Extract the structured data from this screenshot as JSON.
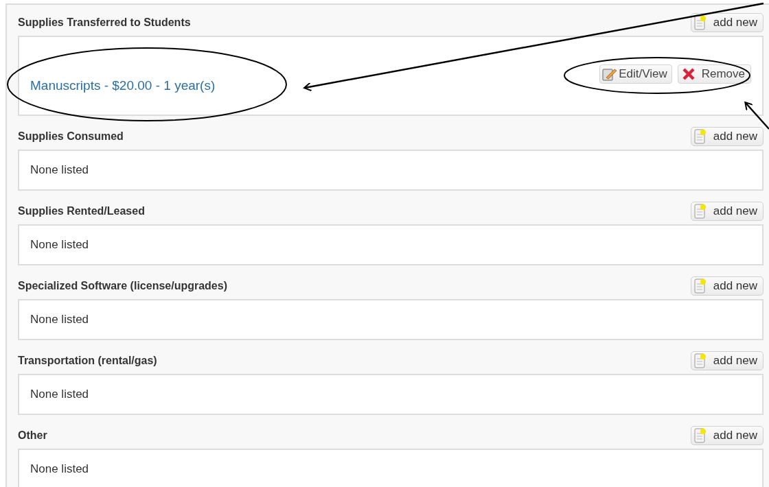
{
  "sections": [
    {
      "title": "Supplies Transferred to Students",
      "add_label": "add new",
      "entries": [
        {
          "text": "Manuscripts - $20.00 - 1 year(s)",
          "actions": [
            {
              "kind": "edit",
              "label": "Edit/View"
            },
            {
              "kind": "remove",
              "label": "Remove"
            }
          ]
        }
      ]
    },
    {
      "title": "Supplies Consumed",
      "add_label": "add new",
      "empty_text": "None listed"
    },
    {
      "title": "Supplies Rented/Leased",
      "add_label": "add new",
      "empty_text": "None listed"
    },
    {
      "title": "Specialized Software (license/upgrades)",
      "add_label": "add new",
      "empty_text": "None listed"
    },
    {
      "title": "Transportation (rental/gas)",
      "add_label": "add new",
      "empty_text": "None listed"
    },
    {
      "title": "Other",
      "add_label": "add new",
      "empty_text": "None listed"
    }
  ]
}
